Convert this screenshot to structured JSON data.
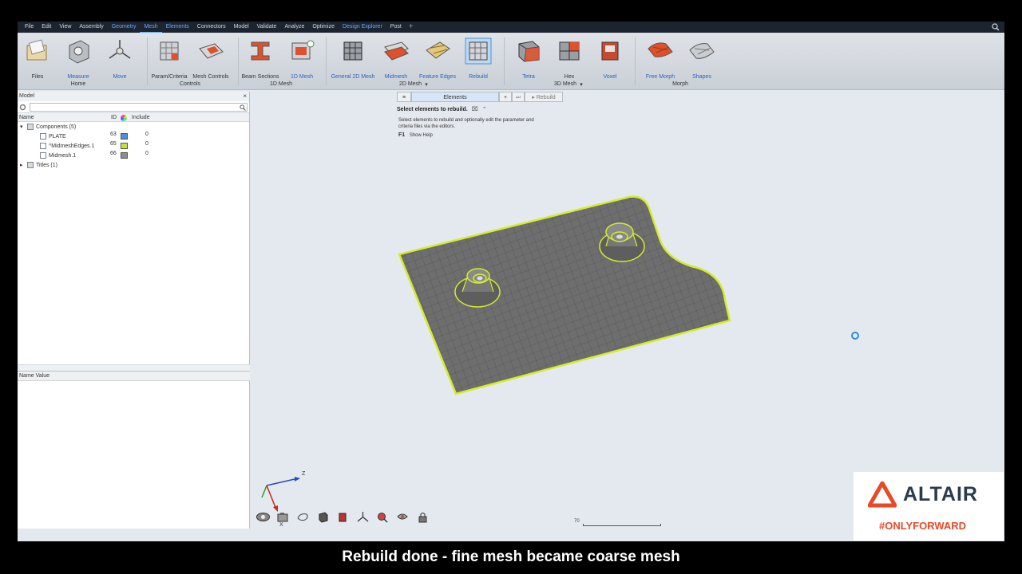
{
  "menu": {
    "items": [
      "File",
      "Edit",
      "View",
      "Assembly",
      "Geometry",
      "Mesh",
      "Elements",
      "Connectors",
      "Model",
      "Validate",
      "Analyze",
      "Optimize",
      "Design Explorer",
      "Post"
    ],
    "plus": "+"
  },
  "ribbon": {
    "tools": {
      "files": "Files",
      "measure": "Measure",
      "move": "Move",
      "param_criteria": "Param/Criteria",
      "mesh_controls": "Mesh Controls",
      "beam_sections": "Beam Sections",
      "mesh_1d": "1D Mesh",
      "general_2d": "General 2D Mesh",
      "midmesh": "Midmesh",
      "feature_edges": "Feature Edges",
      "rebuild": "Rebuild",
      "tetra": "Tetra",
      "hex": "Hex",
      "voxel": "Voxel",
      "free_morph": "Free Morph",
      "shapes": "Shapes"
    },
    "groups": {
      "home": "Home",
      "controls": "Controls",
      "mesh_1d": "1D Mesh",
      "mesh_2d": "2D Mesh",
      "mesh_3d": "3D Mesh",
      "morph": "Morph"
    }
  },
  "model_panel": {
    "title": "Model",
    "close": "×",
    "columns": {
      "name": "Name",
      "id": "ID",
      "include": "Include"
    },
    "tree": [
      {
        "label": "Components (5)",
        "indent": 0,
        "expander": "▾"
      },
      {
        "label": "PLATE",
        "id": "63",
        "include": "0",
        "color": "#4f8fd8",
        "indent": 1
      },
      {
        "label": "^MidmeshEdges.1",
        "id": "65",
        "include": "0",
        "color": "#c9e03a",
        "indent": 1
      },
      {
        "label": "Midmesh.1",
        "id": "66",
        "include": "0",
        "color": "#8e8e8e",
        "indent": 1
      },
      {
        "label": "Titles (1)",
        "indent": 0,
        "expander": "▸"
      }
    ],
    "props_header": "Name Value"
  },
  "context": {
    "menu_icon": "≡",
    "selector": "Elements",
    "plus": "+",
    "rebuild": "Rebuild",
    "title": "Select elements to rebuild.",
    "description": "Select elements to rebuild and optionally edit the parameter and criteria files via the editors.",
    "help_key": "F1",
    "help_label": "Show Help"
  },
  "axes": {
    "z": "Z",
    "x": "X"
  },
  "scale": {
    "value": "70"
  },
  "branding": {
    "name": "ALTAIR",
    "tagline": "#ONLYFORWARD",
    "accent": "#e84a27"
  },
  "caption": "Rebuild done - fine mesh became coarse mesh"
}
